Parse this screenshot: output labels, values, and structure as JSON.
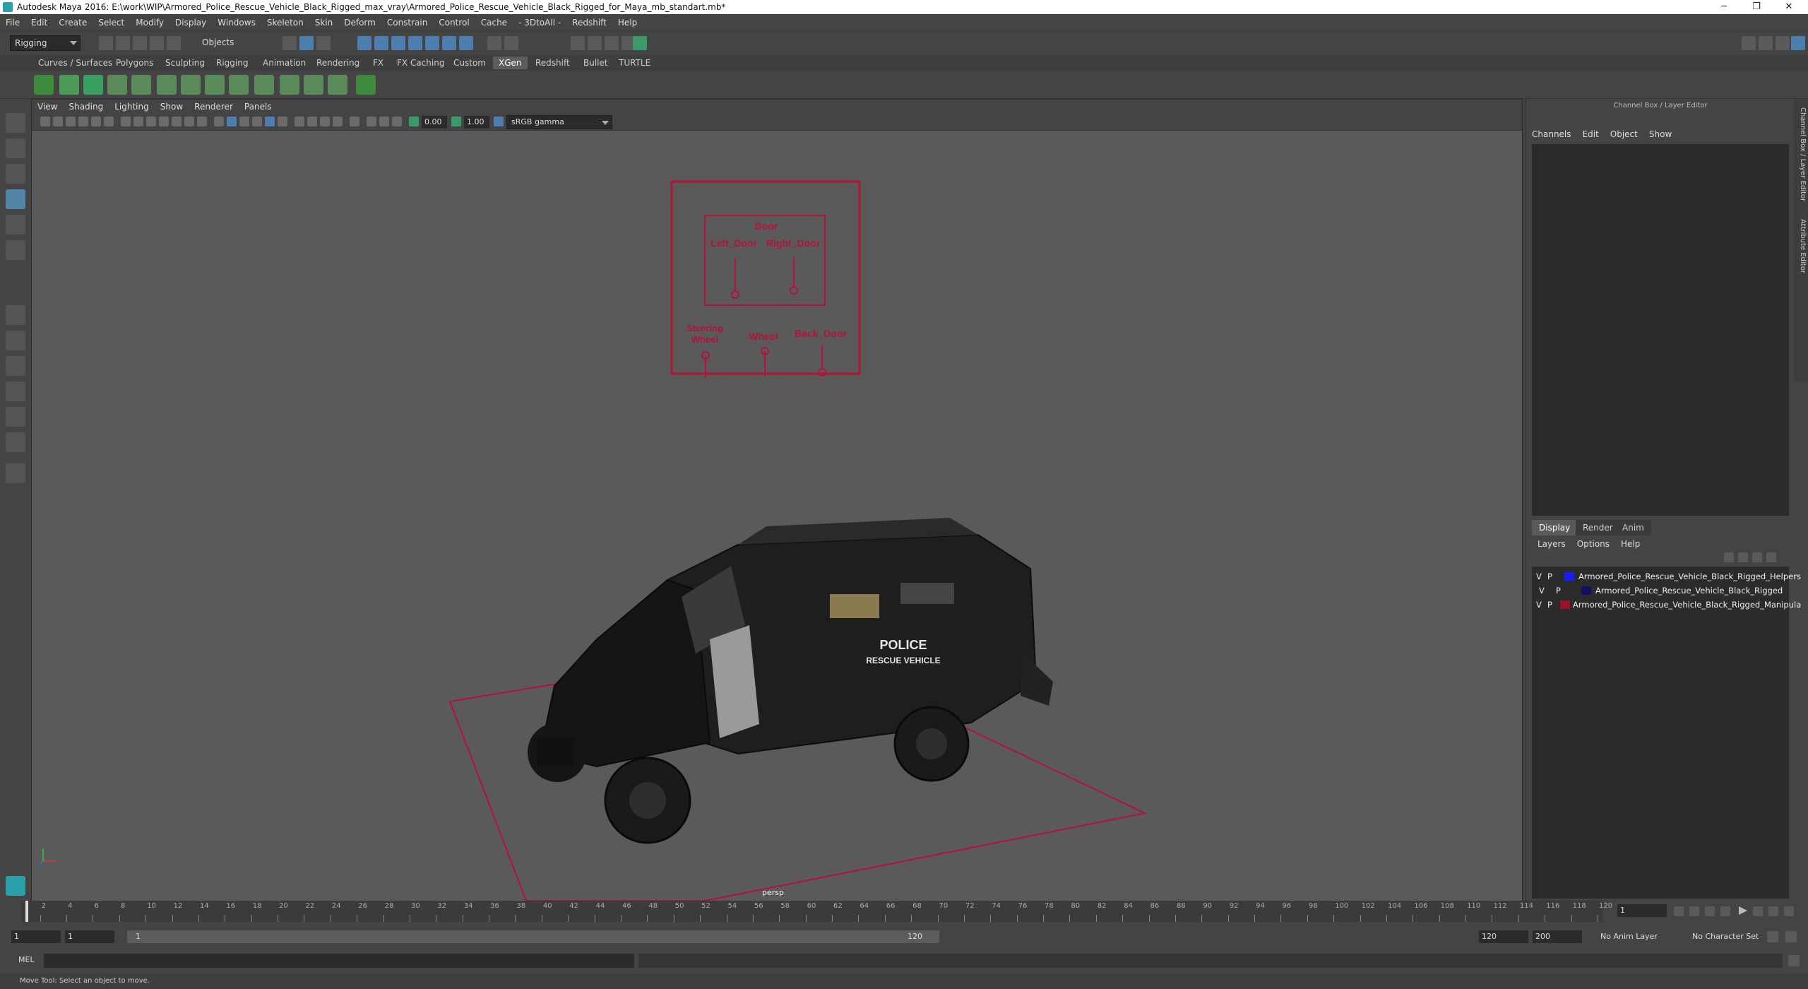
{
  "window": {
    "title": "Autodesk Maya 2016: E:\\work\\WIP\\Armored_Police_Rescue_Vehicle_Black_Rigged_max_vray\\Armored_Police_Rescue_Vehicle_Black_Rigged_for_Maya_mb_standart.mb*",
    "minimize": "─",
    "maximize": "❐",
    "close": "✕"
  },
  "menubar": [
    "File",
    "Edit",
    "Create",
    "Select",
    "Modify",
    "Display",
    "Windows",
    "Skeleton",
    "Skin",
    "Deform",
    "Constrain",
    "Control",
    "Cache",
    "- 3DtoAll -",
    "Redshift",
    "Help"
  ],
  "statusline": {
    "mode": "Rigging",
    "selection_mode": "Objects"
  },
  "shelf_tabs": [
    "Curves / Surfaces",
    "Polygons",
    "Sculpting",
    "Rigging",
    "Animation",
    "Rendering",
    "FX",
    "FX Caching",
    "Custom",
    "XGen",
    "Redshift",
    "Bullet",
    "TURTLE"
  ],
  "shelf_active_tab": "XGen",
  "viewport": {
    "menus": [
      "View",
      "Shading",
      "Lighting",
      "Show",
      "Renderer",
      "Panels"
    ],
    "exposure": "0.00",
    "gamma": "1.00",
    "color_space": "sRGB gamma",
    "camera": "persp",
    "rig_labels": {
      "door": "Door",
      "left_door": "Left_Door",
      "right_door": "Right_Door",
      "steering": "Steering\nWheel",
      "wheel": "Wheel",
      "back_door": "Back_Door"
    },
    "vehicle_text": {
      "line1": "POLICE",
      "line2": "RESCUE VEHICLE"
    },
    "colors": {
      "rig": "#b5123a",
      "background": "#5a5a5a"
    }
  },
  "channel_box": {
    "title": "Channel Box / Layer Editor",
    "menus": [
      "Channels",
      "Edit",
      "Object",
      "Show"
    ]
  },
  "layer_editor": {
    "tabs": [
      "Display",
      "Render",
      "Anim"
    ],
    "active_tab": "Display",
    "menus": [
      "Layers",
      "Options",
      "Help"
    ],
    "layers": [
      {
        "v": "V",
        "p": "P",
        "color": "#1a1aff",
        "name": "Armored_Police_Rescue_Vehicle_Black_Rigged_Helpers"
      },
      {
        "v": "V",
        "p": "P",
        "color": "#101060",
        "name": "Armored_Police_Rescue_Vehicle_Black_Rigged"
      },
      {
        "v": "V",
        "p": "P",
        "color": "#a0102a",
        "name": "Armored_Police_Rescue_Vehicle_Black_Rigged_Manipula"
      }
    ]
  },
  "side_tabs": [
    "Channel Box / Layer Editor",
    "Attribute Editor"
  ],
  "timeline": {
    "start": 1,
    "end": 120,
    "ticks": [
      2,
      4,
      6,
      8,
      10,
      12,
      14,
      16,
      18,
      20,
      22,
      24,
      26,
      28,
      30,
      32,
      34,
      36,
      38,
      40,
      42,
      44,
      46,
      48,
      50,
      52,
      54,
      56,
      58,
      60,
      62,
      64,
      66,
      68,
      70,
      72,
      74,
      76,
      78,
      80,
      82,
      84,
      86,
      88,
      90,
      92,
      94,
      96,
      98,
      100,
      102,
      104,
      106,
      108,
      110,
      112,
      114,
      116,
      118,
      120
    ],
    "current_frame": "1"
  },
  "range": {
    "start": "1",
    "inner_start": "1",
    "bar_start": "1",
    "bar_end": "120",
    "playback_end": "120",
    "anim_end": "200",
    "anim_layer": "No Anim Layer",
    "char_set": "No Character Set"
  },
  "command_line": {
    "label": "MEL"
  },
  "help_line": "Move Tool: Select an object to move."
}
